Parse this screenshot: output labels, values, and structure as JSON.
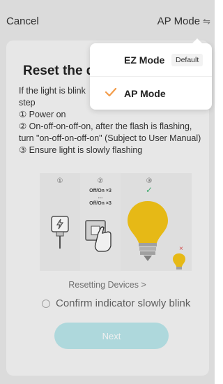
{
  "header": {
    "cancel_label": "Cancel",
    "mode_label": "AP Mode",
    "swap_icon": "⇋"
  },
  "content": {
    "title": "Reset the de",
    "desc_lines": [
      "If the light is blink",
      "step",
      "① Power on",
      "② On-off-on-off-on, after the flash is flashing, turn \"on-off-on-off-on\" (Subject to User Manual)",
      "③ Ensure  light is slowly flashing"
    ],
    "illustration": {
      "step1": "①",
      "step2": "②",
      "step3": "③",
      "cmd1": "Off/On ×3",
      "cmd_dots": "…",
      "cmd2": "Off/On ×3",
      "check": "✓",
      "cross": "×"
    },
    "resetting_link": "Resetting Devices >",
    "confirm_label": "Confirm indicator slowly blink",
    "next_label": "Next"
  },
  "menu": {
    "items": [
      {
        "label": "EZ Mode",
        "badge": "Default",
        "selected": false
      },
      {
        "label": "AP Mode",
        "badge": "",
        "selected": true
      }
    ]
  },
  "colors": {
    "accent": "#f39c4a",
    "next_button": "#b9e6ea",
    "check_green": "#3cb371",
    "bulb_yellow": "#f5c518"
  }
}
